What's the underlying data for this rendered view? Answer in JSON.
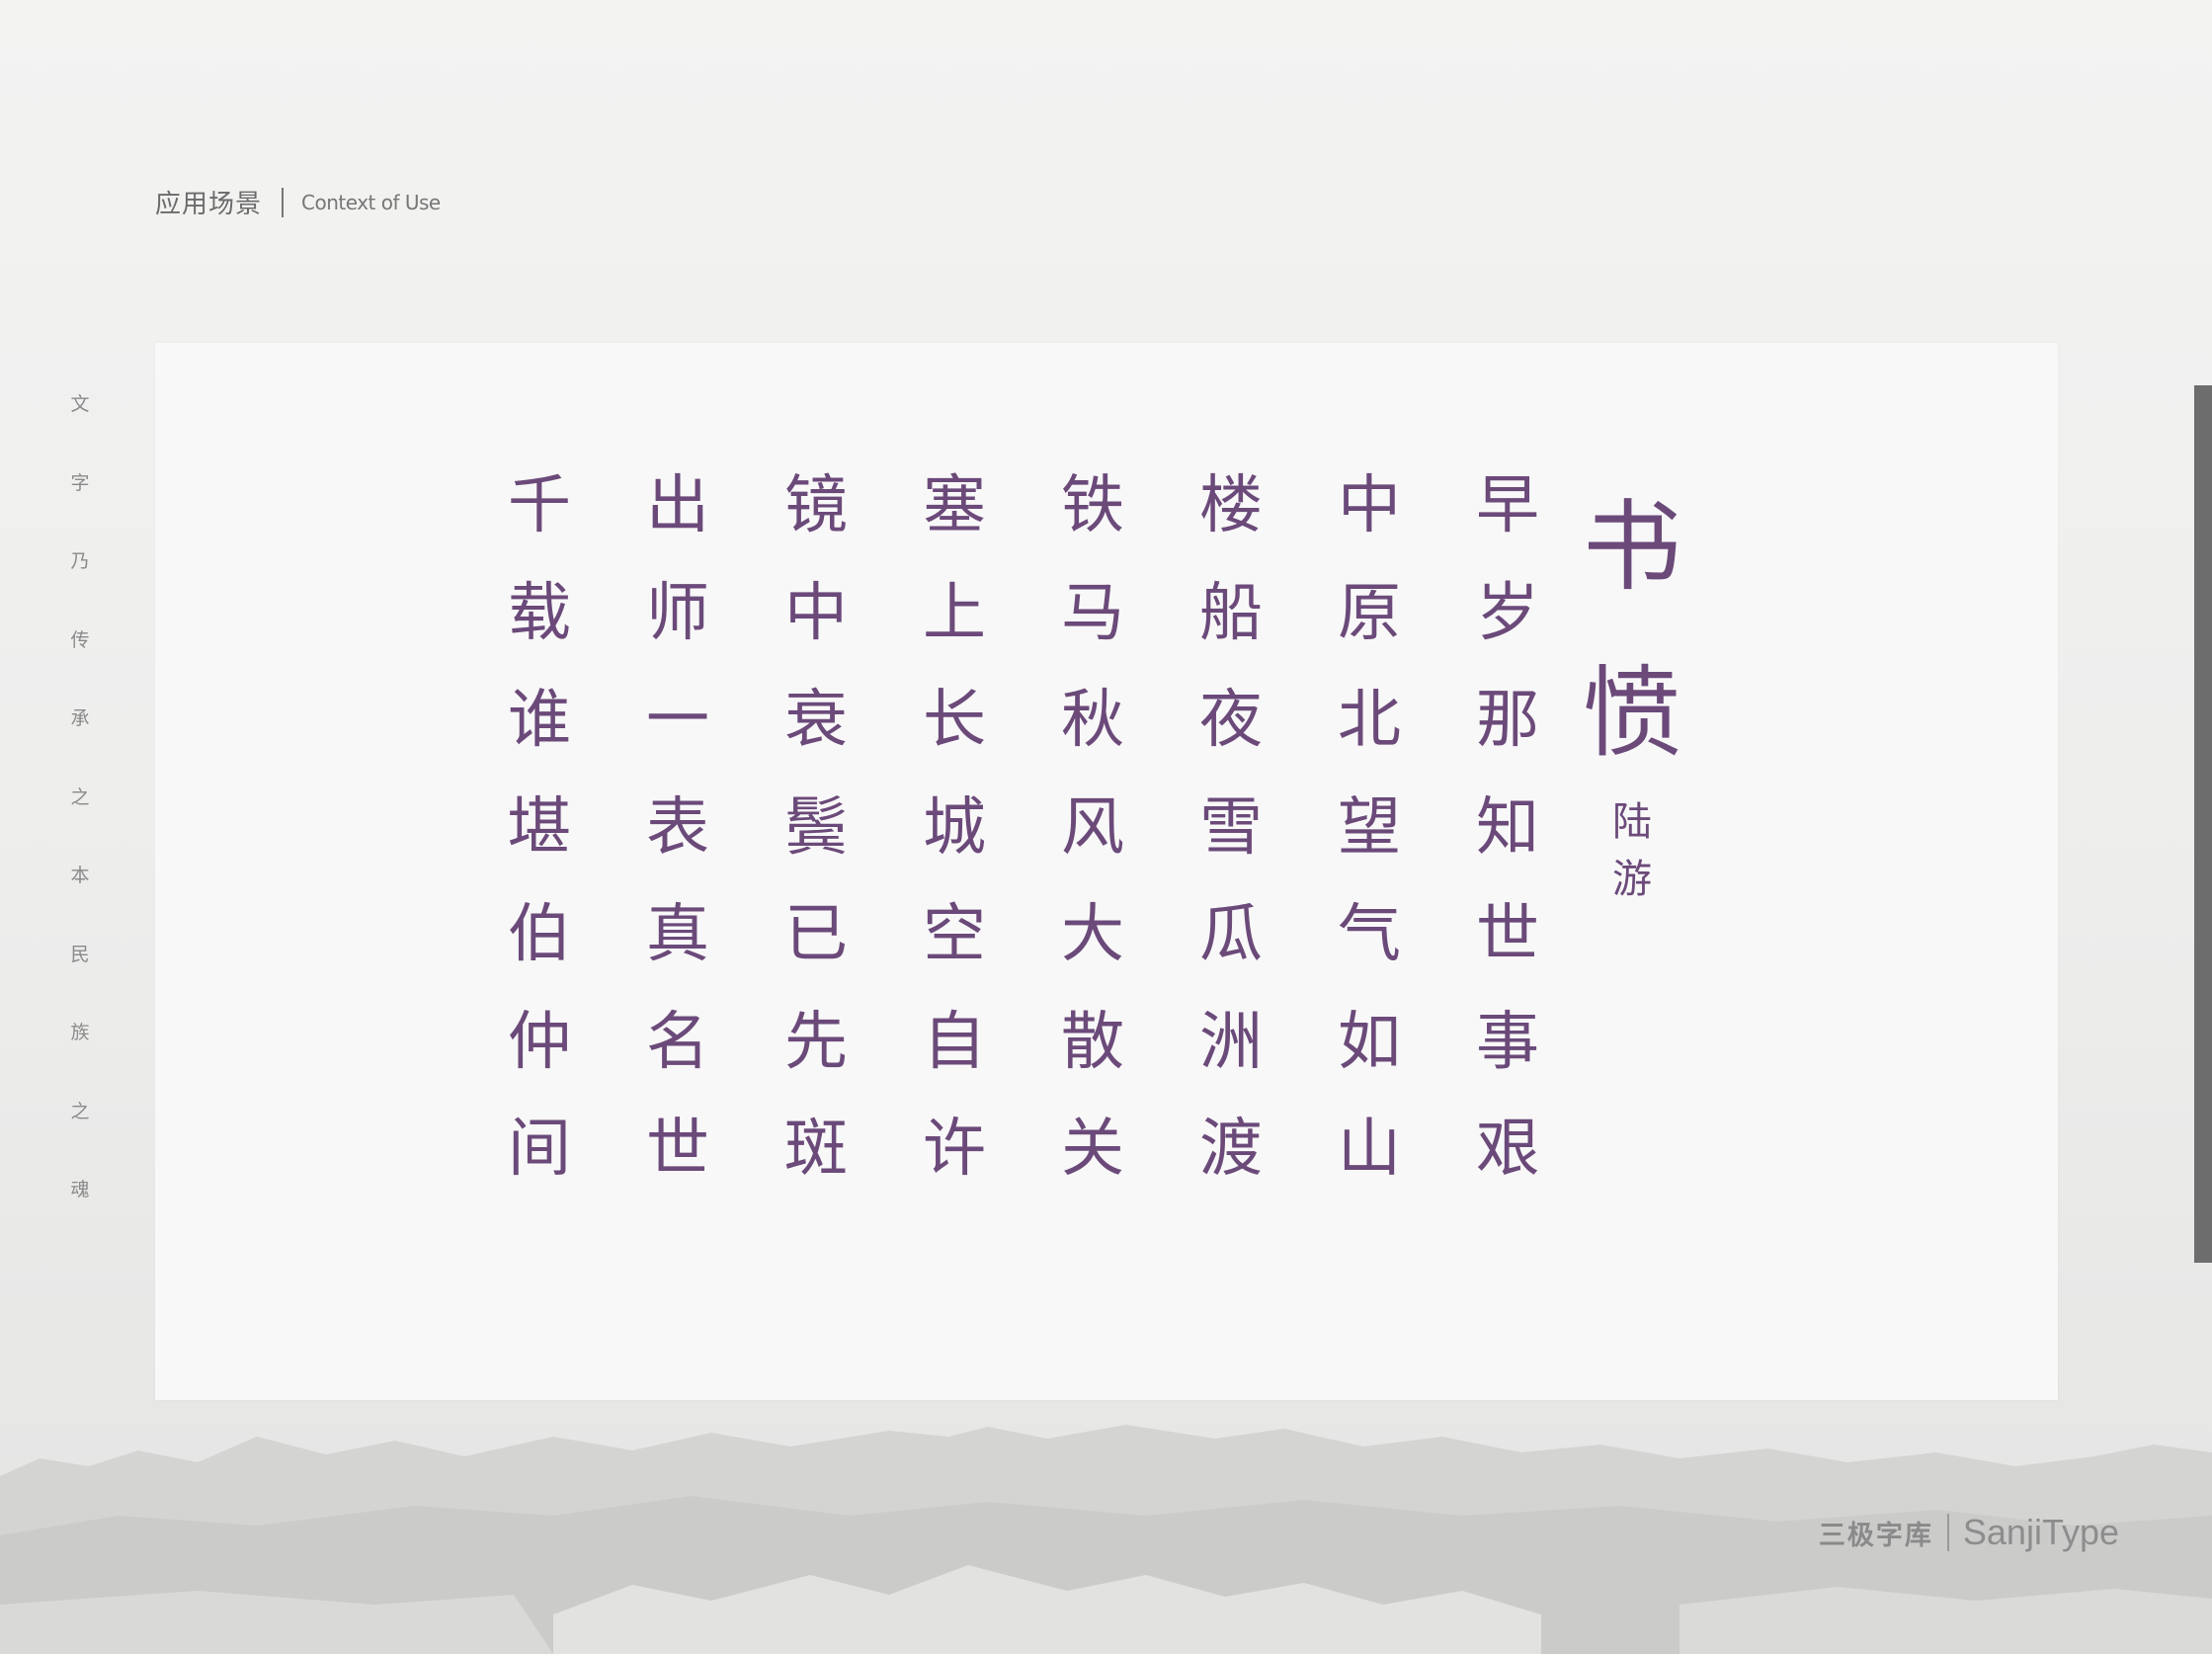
{
  "header": {
    "title_zh": "应用场景",
    "title_en": "Context of Use"
  },
  "side_text": [
    "文",
    "字",
    "乃",
    "传",
    "承",
    "之",
    "本",
    "民",
    "族",
    "之",
    "魂"
  ],
  "poem": {
    "title": [
      "书",
      "愤"
    ],
    "author": [
      "陆",
      "游"
    ],
    "columns": [
      [
        "早",
        "岁",
        "那",
        "知",
        "世",
        "事",
        "艰"
      ],
      [
        "中",
        "原",
        "北",
        "望",
        "气",
        "如",
        "山"
      ],
      [
        "楼",
        "船",
        "夜",
        "雪",
        "瓜",
        "洲",
        "渡"
      ],
      [
        "铁",
        "马",
        "秋",
        "风",
        "大",
        "散",
        "关"
      ],
      [
        "塞",
        "上",
        "长",
        "城",
        "空",
        "自",
        "许"
      ],
      [
        "镜",
        "中",
        "衰",
        "鬓",
        "已",
        "先",
        "斑"
      ],
      [
        "出",
        "师",
        "一",
        "表",
        "真",
        "名",
        "世"
      ],
      [
        "千",
        "载",
        "谁",
        "堪",
        "伯",
        "仲",
        "间"
      ]
    ]
  },
  "brand": {
    "name_zh": "三极字库",
    "name_en": "SanjiType"
  },
  "colors": {
    "poem_purple": "#6b4a7a",
    "background": "#efefee",
    "card": "#f8f8f8"
  }
}
